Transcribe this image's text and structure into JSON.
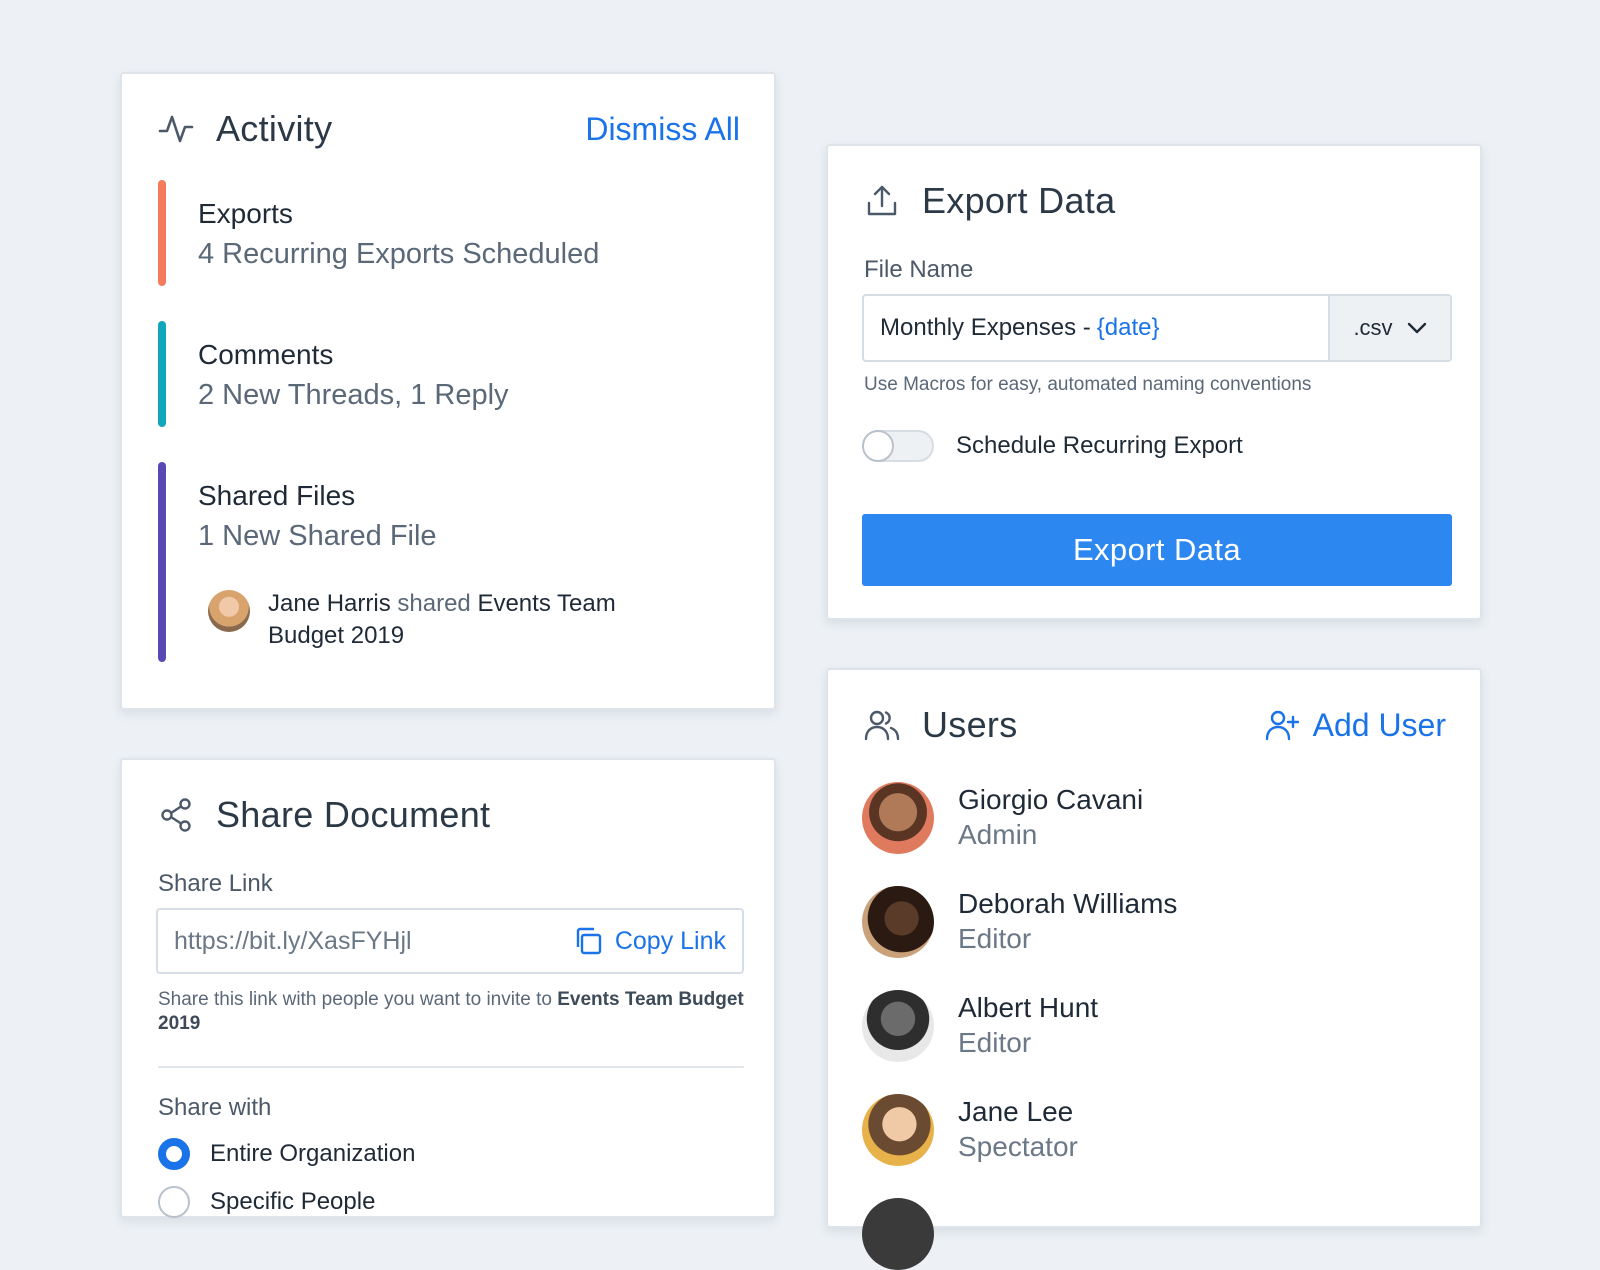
{
  "activity": {
    "title": "Activity",
    "dismiss_label": "Dismiss All",
    "items": [
      {
        "title": "Exports",
        "subtitle": "4 Recurring Exports Scheduled",
        "color": "#f47c5c"
      },
      {
        "title": "Comments",
        "subtitle": "2 New Threads, 1 Reply",
        "color": "#12a6bd"
      },
      {
        "title": "Shared Files",
        "subtitle": "1 New Shared File",
        "color": "#5b48b3"
      }
    ],
    "shared_event": {
      "user": "Jane Harris",
      "verb": "shared",
      "object": "Events Team Budget 2019"
    }
  },
  "share": {
    "title": "Share Document",
    "link_label": "Share Link",
    "link_value": "https://bit.ly/XasFYHjl",
    "copy_label": "Copy Link",
    "hint_prefix": "Share this link with people you want to invite to",
    "hint_doc": "Events Team Budget 2019",
    "share_with_label": "Share with",
    "options": [
      {
        "label": "Entire Organization",
        "selected": true
      },
      {
        "label": "Specific People",
        "selected": false
      }
    ]
  },
  "export": {
    "title": "Export Data",
    "file_name_label": "File Name",
    "file_name_value": "Monthly Expenses -",
    "file_name_macro": "{date}",
    "extension": ".csv",
    "macro_hint": "Use Macros for easy, automated naming conventions",
    "toggle_label": "Schedule Recurring Export",
    "toggle_on": false,
    "button_label": "Export Data"
  },
  "users": {
    "title": "Users",
    "add_label": "Add User",
    "list": [
      {
        "name": "Giorgio Cavani",
        "role": "Admin"
      },
      {
        "name": "Deborah Williams",
        "role": "Editor"
      },
      {
        "name": "Albert Hunt",
        "role": "Editor"
      },
      {
        "name": "Jane Lee",
        "role": "Spectator"
      }
    ]
  },
  "colors": {
    "accent": "#1a73e8",
    "button": "#2d87f0",
    "background": "#edf1f5"
  }
}
